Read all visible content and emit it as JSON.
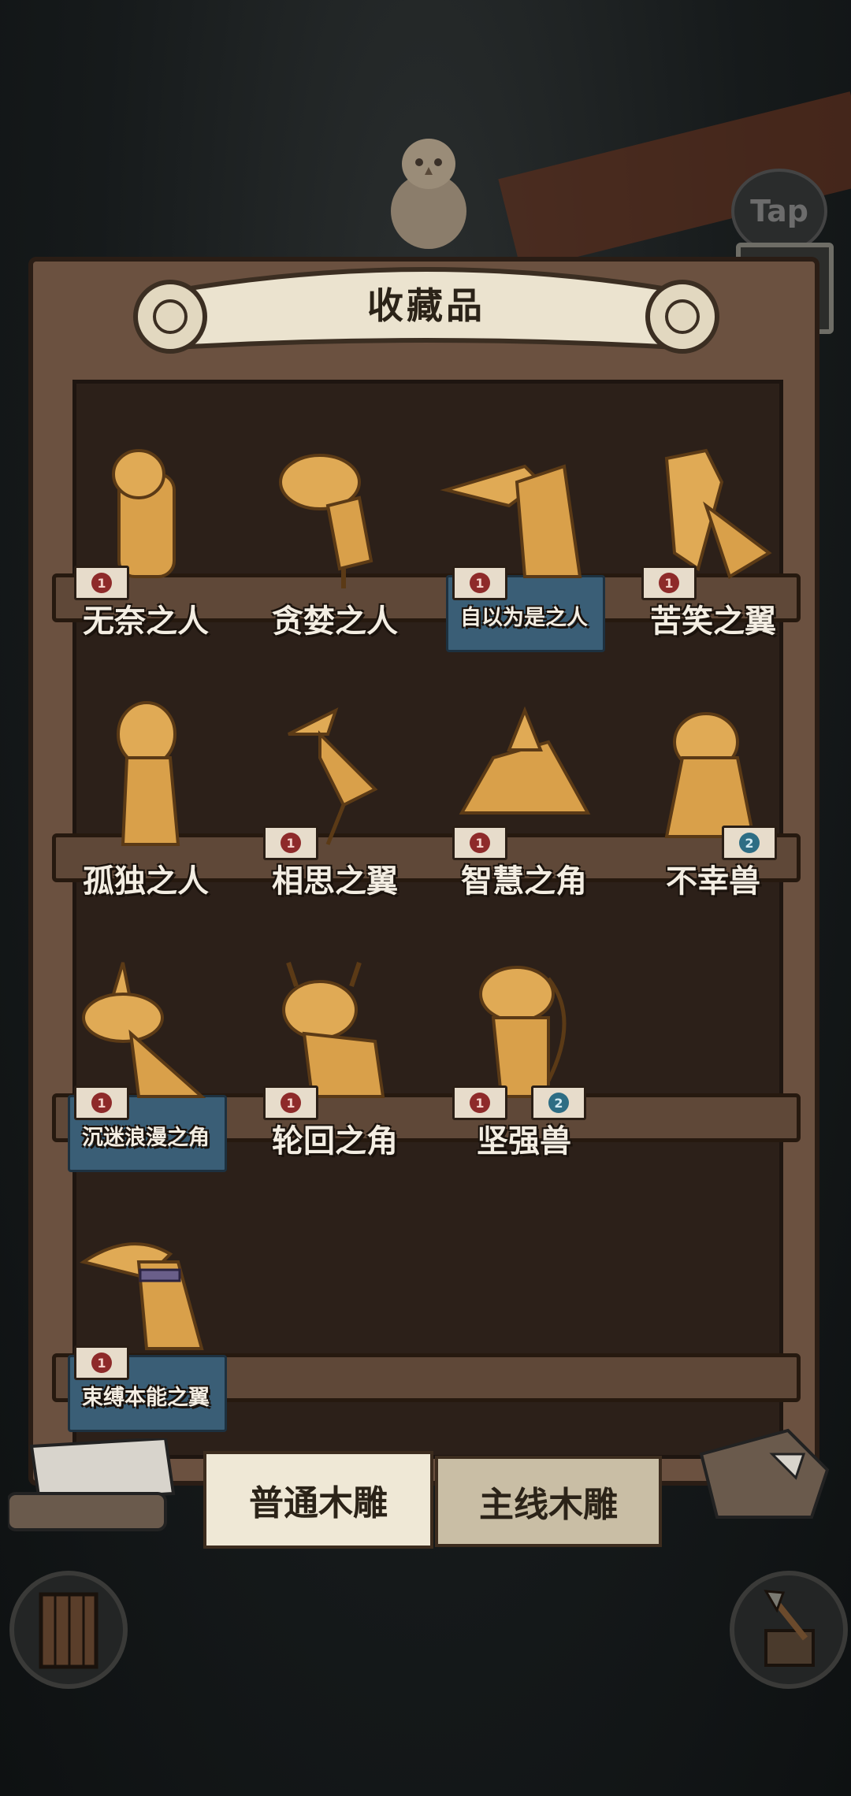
{
  "screen": {
    "title": "收藏品",
    "tap_label": "Tap"
  },
  "items": [
    {
      "label": "无奈之人",
      "count": "1",
      "badge": "red",
      "highlight": false,
      "figure": "hunched-man-carving"
    },
    {
      "label": "贪婪之人",
      "count": "",
      "badge": "",
      "highlight": false,
      "figure": "greedy-man-carving"
    },
    {
      "label": "自以为是之人",
      "count": "1",
      "badge": "red",
      "highlight": true,
      "figure": "long-nose-man-carving"
    },
    {
      "label": "苦笑之翼",
      "count": "1",
      "badge": "red",
      "highlight": false,
      "figure": "bird-carving"
    },
    {
      "label": "孤独之人",
      "count": "",
      "badge": "",
      "highlight": false,
      "figure": "girl-carving"
    },
    {
      "label": "相思之翼",
      "count": "1",
      "badge": "red",
      "highlight": false,
      "figure": "heron-carving"
    },
    {
      "label": "智慧之角",
      "count": "1",
      "badge": "red",
      "highlight": false,
      "figure": "turtle-carving"
    },
    {
      "label": "不幸兽",
      "count": "2",
      "badge": "blue",
      "highlight": false,
      "figure": "seal-beast-carving"
    },
    {
      "label": "沉迷浪漫之角",
      "count": "1",
      "badge": "red",
      "highlight": true,
      "figure": "horned-dog-carving"
    },
    {
      "label": "轮回之角",
      "count": "1",
      "badge": "red",
      "highlight": false,
      "figure": "ox-carving"
    },
    {
      "label": "坚强兽",
      "count": "1",
      "count2": "2",
      "badge": "red",
      "highlight": false,
      "figure": "strong-beast-carving"
    },
    {
      "label": "束缚本能之翼",
      "count": "1",
      "badge": "red",
      "highlight": true,
      "figure": "collared-bird-carving"
    }
  ],
  "tabs": [
    {
      "label": "普通木雕",
      "active": true
    },
    {
      "label": "主线木雕",
      "active": false
    }
  ],
  "colors": {
    "wood": "#6b5140",
    "wood_dark": "#2c2019",
    "carving": "#d9a04a",
    "paper": "#ebe3cf",
    "accent_blue": "#3a5e76"
  }
}
